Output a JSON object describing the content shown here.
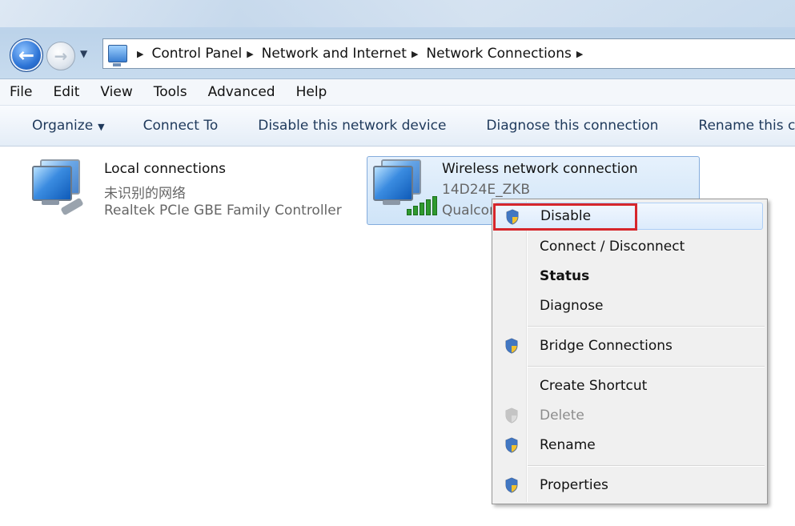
{
  "address": {
    "crumbs": [
      "Control Panel",
      "Network and Internet",
      "Network Connections"
    ]
  },
  "menubar": {
    "items": [
      "File",
      "Edit",
      "View",
      "Tools",
      "Advanced",
      "Help"
    ]
  },
  "commandbar": {
    "organize": "Organize",
    "connect_to": "Connect To",
    "disable_device": "Disable this network device",
    "diagnose": "Diagnose this connection",
    "rename": "Rename this connection"
  },
  "connections": [
    {
      "name": "Local connections",
      "status": "未识别的网络",
      "adapter": "Realtek PCIe GBE Family Controller"
    },
    {
      "name": "Wireless network connection",
      "status": "14D24E_ZKB",
      "adapter": "Qualcomm Atheros"
    }
  ],
  "context_menu": {
    "items": {
      "disable": "Disable",
      "connect_disconnect": "Connect / Disconnect",
      "status": "Status",
      "diagnose": "Diagnose",
      "bridge": "Bridge Connections",
      "shortcut": "Create Shortcut",
      "delete": "Delete",
      "rename": "Rename",
      "properties": "Properties"
    }
  },
  "colors": {
    "highlight_box": "#d6262b",
    "selection_border": "#84acdd",
    "command_text": "#1e395b"
  },
  "icons": {
    "back": "back-arrow-icon",
    "forward": "forward-arrow-icon",
    "uac_shield": "uac-shield-icon",
    "network_adapter": "network-adapter-icon",
    "wifi_signal": "wifi-signal-icon"
  }
}
